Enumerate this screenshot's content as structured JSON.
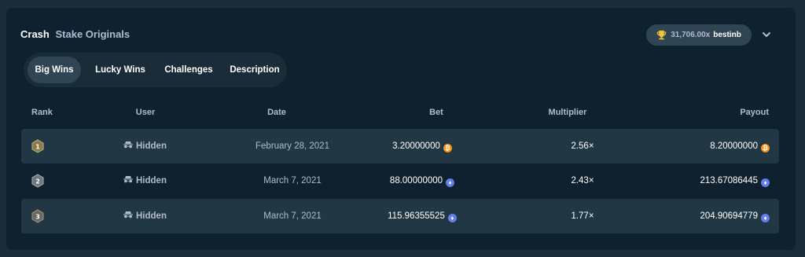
{
  "header": {
    "title": "Crash",
    "subtitle": "Stake Originals"
  },
  "badge": {
    "multiplier": "31,706.00x",
    "user": "bestinb"
  },
  "tabs": [
    {
      "label": "Big Wins",
      "active": true
    },
    {
      "label": "Lucky Wins",
      "active": false
    },
    {
      "label": "Challenges",
      "active": false
    },
    {
      "label": "Description",
      "active": false
    }
  ],
  "table": {
    "columns": [
      "Rank",
      "User",
      "Date",
      "Bet",
      "Multiplier",
      "Payout"
    ],
    "rows": [
      {
        "rank": "1",
        "user": "Hidden",
        "date": "February 28, 2021",
        "bet": "3.20000000",
        "bet_currency": "btc",
        "multiplier": "2.56×",
        "payout": "8.20000000",
        "payout_currency": "btc"
      },
      {
        "rank": "2",
        "user": "Hidden",
        "date": "March 7, 2021",
        "bet": "88.00000000",
        "bet_currency": "eth",
        "multiplier": "2.43×",
        "payout": "213.67086445",
        "payout_currency": "eth"
      },
      {
        "rank": "3",
        "user": "Hidden",
        "date": "March 7, 2021",
        "bet": "115.96355525",
        "bet_currency": "eth",
        "multiplier": "1.77×",
        "payout": "204.90694779",
        "payout_currency": "eth"
      }
    ]
  },
  "colors": {
    "accent_btc": "#f7931a",
    "accent_eth": "#627eea",
    "trophy": "#f0c33c"
  }
}
